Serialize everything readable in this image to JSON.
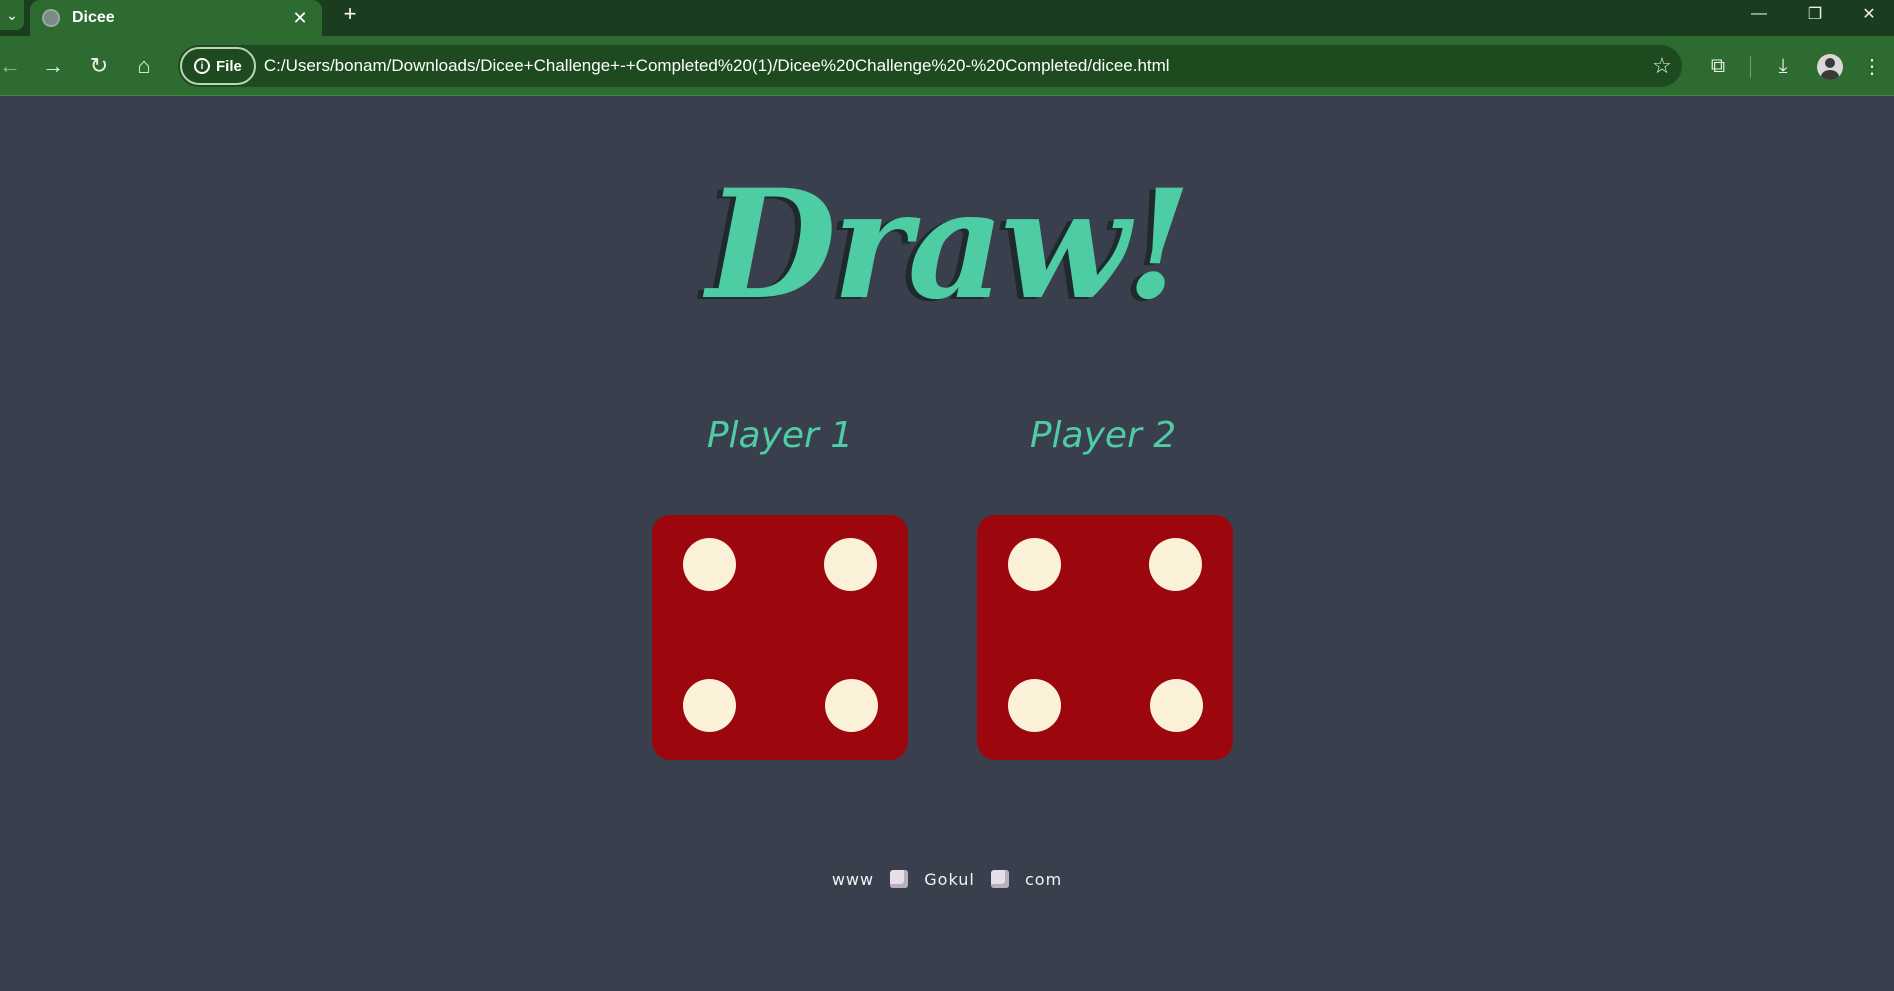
{
  "browser": {
    "tab_title": "Dicee",
    "url": "C:/Users/bonam/Downloads/Dicee+Challenge+-+Completed%20(1)/Dicee%20Challenge%20-%20Completed/dicee.html",
    "site_chip": "File"
  },
  "game": {
    "headline": "Draw!",
    "players": [
      {
        "label": "Player 1",
        "die_value": 4
      },
      {
        "label": "Player 2",
        "die_value": 4
      }
    ]
  },
  "footer": {
    "part1": "www",
    "part2": "Gokul",
    "part3": "com"
  },
  "colors": {
    "background": "#393f4d",
    "accent": "#4ecca3",
    "die": "#9b070d",
    "pip": "#fbf0d8",
    "browser_frame": "#2e6b30"
  }
}
